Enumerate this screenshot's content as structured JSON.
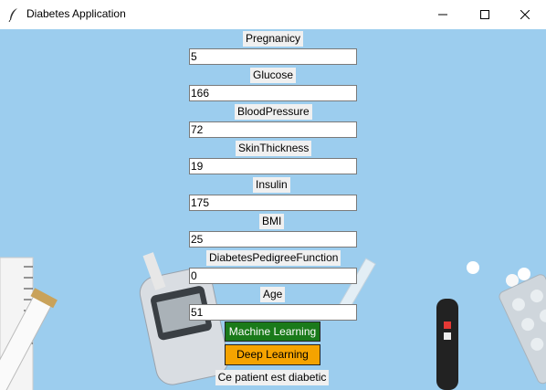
{
  "window": {
    "title": "Diabetes Application"
  },
  "colors": {
    "background": "#9ccdee",
    "ml_button": "#1a7a1a",
    "dl_button": "#f5a300"
  },
  "fields": [
    {
      "label": "Pregnanicy",
      "value": "5"
    },
    {
      "label": "Glucose",
      "value": "166"
    },
    {
      "label": "BloodPressure",
      "value": "72"
    },
    {
      "label": "SkinThickness",
      "value": "19"
    },
    {
      "label": "Insulin",
      "value": "175"
    },
    {
      "label": "BMI",
      "value": "25"
    },
    {
      "label": "DiabetesPedigreeFunction",
      "value": "0"
    },
    {
      "label": "Age",
      "value": "51"
    }
  ],
  "buttons": {
    "machine_learning": "Machine Learning",
    "deep_learning": "Deep Learning"
  },
  "result": "Ce patient est diabetic"
}
